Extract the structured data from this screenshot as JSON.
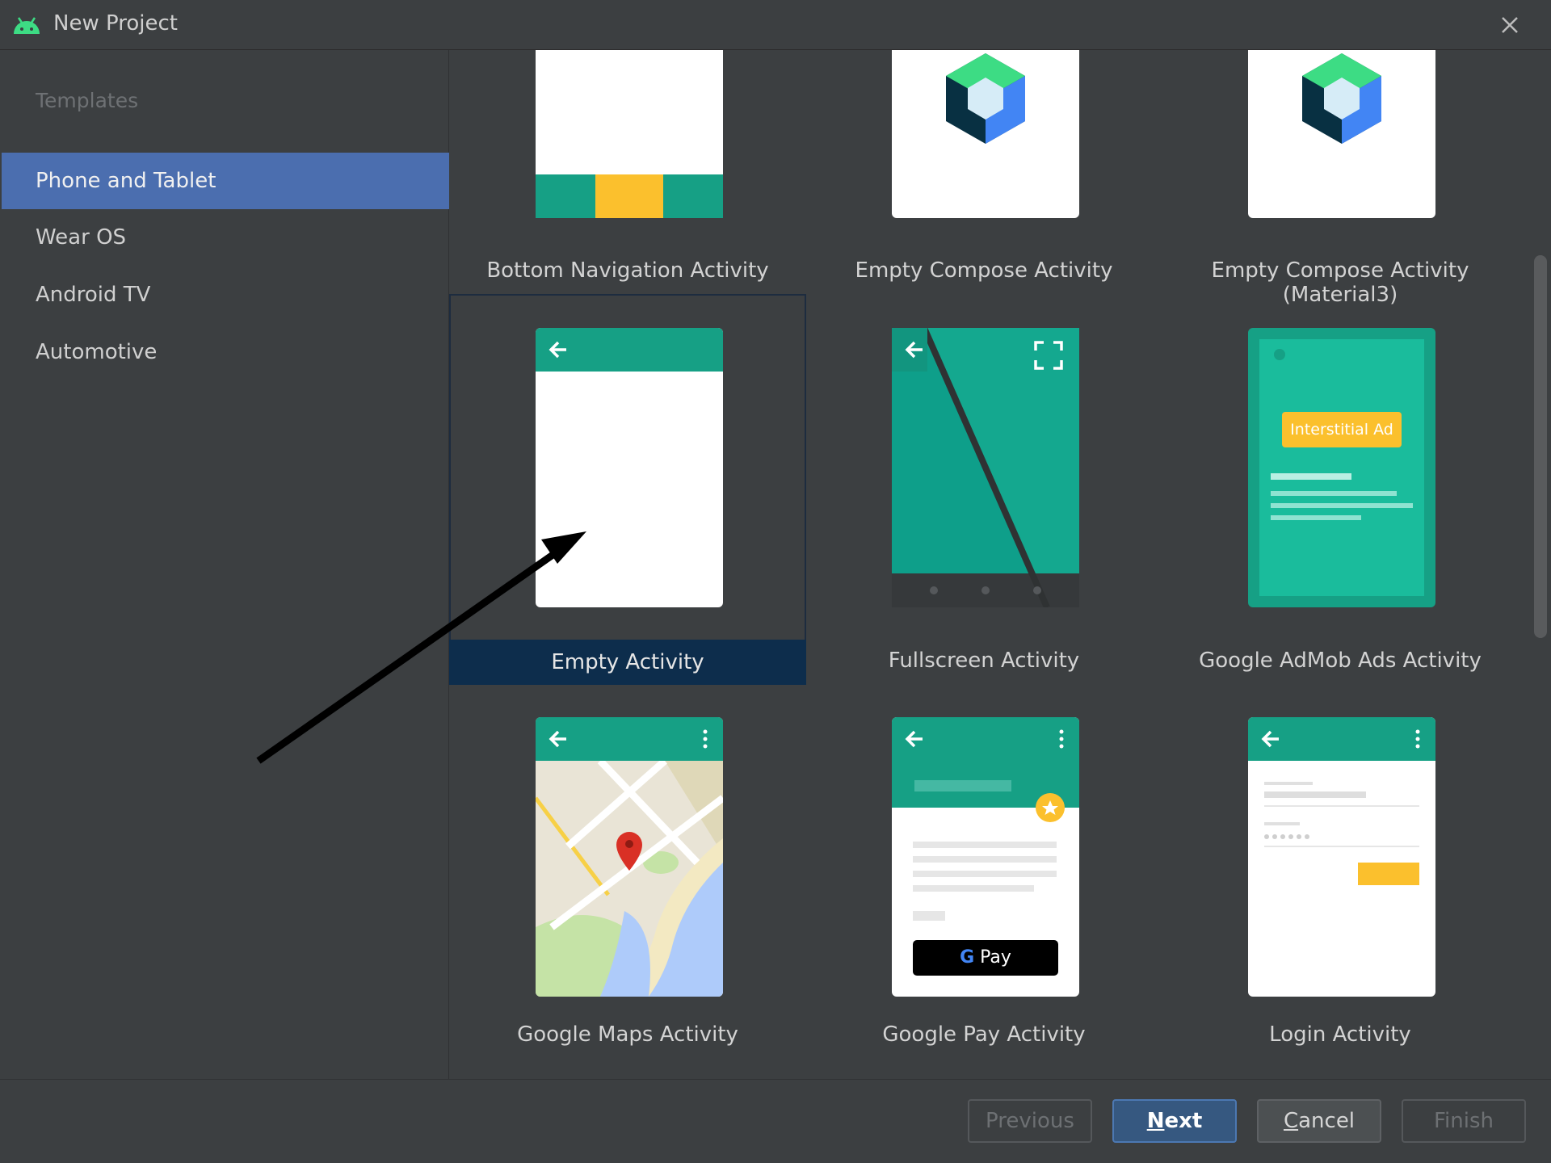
{
  "window": {
    "title": "New Project"
  },
  "sidebar": {
    "header": "Templates",
    "items": [
      {
        "label": "Phone and Tablet",
        "selected": true
      },
      {
        "label": "Wear OS",
        "selected": false
      },
      {
        "label": "Android TV",
        "selected": false
      },
      {
        "label": "Automotive",
        "selected": false
      }
    ]
  },
  "templates": [
    {
      "label": "Bottom Navigation Activity",
      "selected": false
    },
    {
      "label": "Empty Compose Activity",
      "selected": false
    },
    {
      "label": "Empty Compose Activity (Material3)",
      "selected": false
    },
    {
      "label": "Empty Activity",
      "selected": true
    },
    {
      "label": "Fullscreen Activity",
      "selected": false
    },
    {
      "label": "Google AdMob Ads Activity",
      "selected": false
    },
    {
      "label": "Google Maps Activity",
      "selected": false
    },
    {
      "label": "Google Pay Activity",
      "selected": false
    },
    {
      "label": "Login Activity",
      "selected": false
    }
  ],
  "thumb_text": {
    "interstitial": "Interstitial Ad",
    "gpay": "Pay",
    "gpay_g": "G"
  },
  "buttons": {
    "previous": "Previous",
    "next_mnemonic": "N",
    "next_rest": "ext",
    "cancel_mnemonic": "C",
    "cancel_rest": "ancel",
    "finish": "Finish"
  },
  "colors": {
    "accent": "#4b6eaf",
    "teal": "#16a085",
    "selected_tile": "#0d2d4c",
    "yellow": "#fbc02d"
  }
}
